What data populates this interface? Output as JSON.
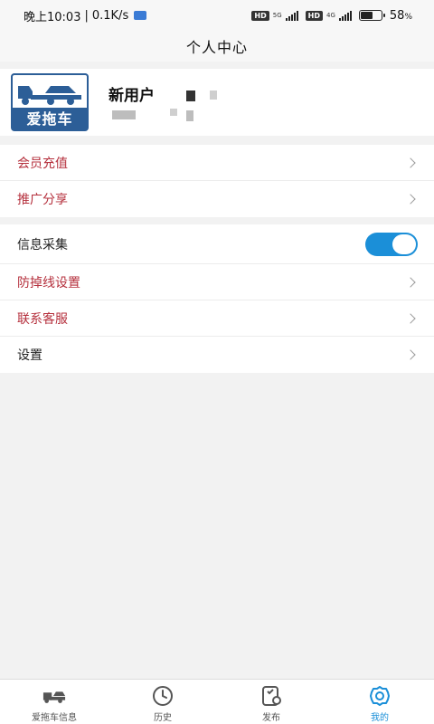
{
  "status_bar": {
    "time": "晚上10:03",
    "separator": "|",
    "speed": "0.1K/s",
    "hd1": "HD",
    "net1": "5G",
    "hd2": "HD",
    "net2": "4G",
    "battery_percent": 58,
    "battery_label": "58",
    "percent_sign": "%"
  },
  "nav": {
    "title": "个人中心"
  },
  "profile": {
    "logo_text": "爱拖车",
    "username": "新用户"
  },
  "colors": {
    "accent": "#1b8fd8",
    "menu_red": "#b5303d",
    "logo_blue": "#2c5e97"
  },
  "menu_group1": [
    {
      "label": "会员充值"
    },
    {
      "label": "推广分享"
    }
  ],
  "menu_group2": {
    "info_collect": {
      "label": "信息采集",
      "toggle_on": true
    },
    "items": [
      {
        "label": "防掉线设置"
      },
      {
        "label": "联系客服"
      },
      {
        "label": "设置"
      }
    ]
  },
  "tabbar": {
    "tabs": [
      {
        "label": "爱拖车信息",
        "icon": "tow-truck-icon"
      },
      {
        "label": "历史",
        "icon": "clock-icon"
      },
      {
        "label": "发布",
        "icon": "publish-icon"
      },
      {
        "label": "我的",
        "icon": "gear-icon",
        "active": true
      }
    ]
  }
}
